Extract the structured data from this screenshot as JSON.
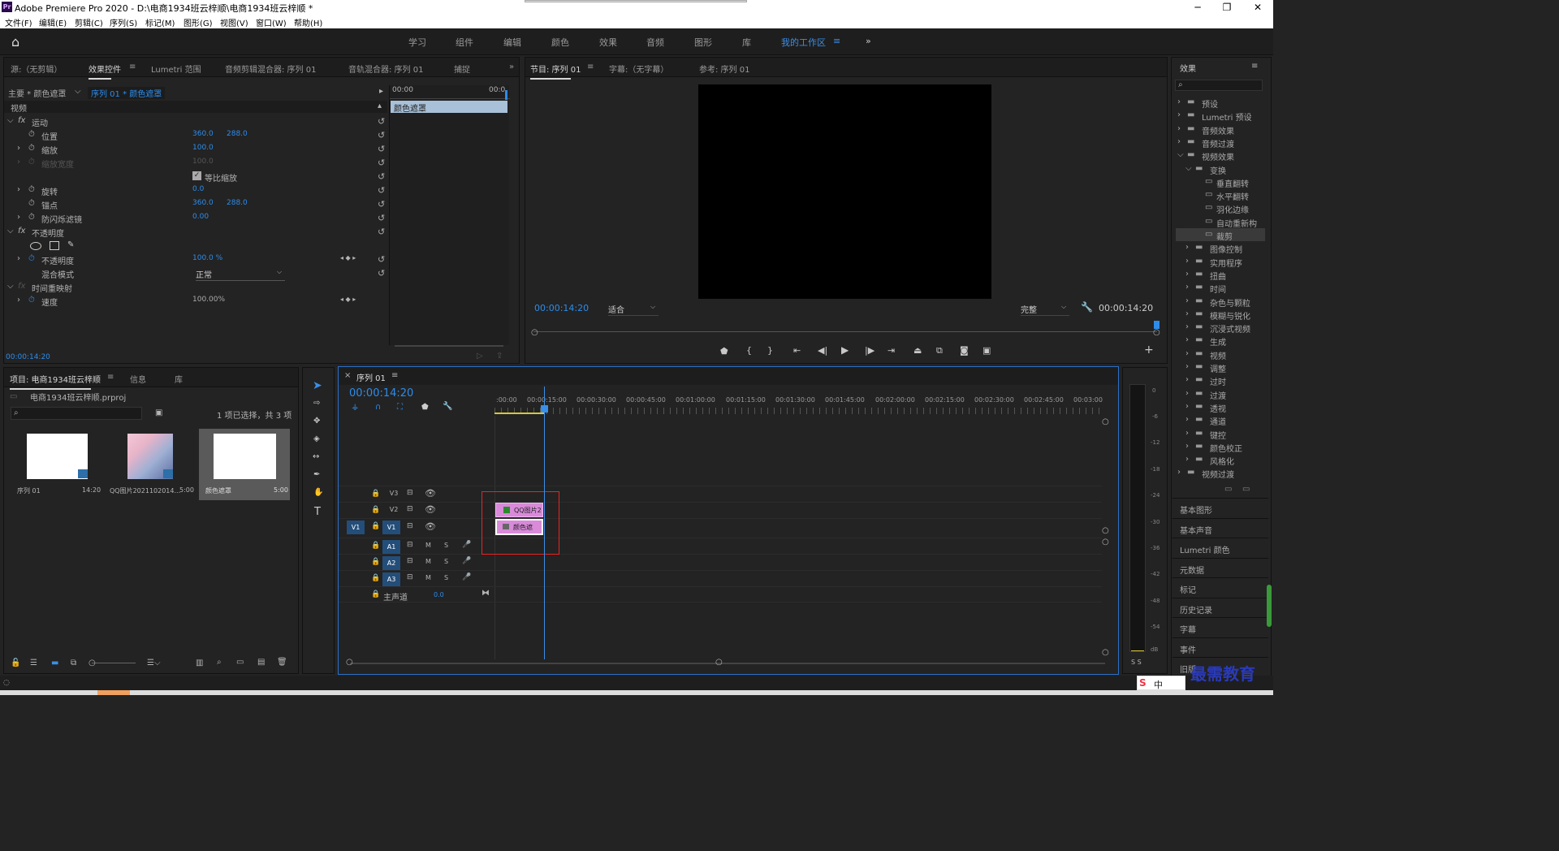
{
  "app": {
    "title": "Adobe Premiere Pro 2020 - D:\\电商1934班云梓顺\\电商1934班云梓顺 *"
  },
  "menu": [
    "文件(F)",
    "编辑(E)",
    "剪辑(C)",
    "序列(S)",
    "标记(M)",
    "图形(G)",
    "视图(V)",
    "窗口(W)",
    "帮助(H)"
  ],
  "workspaces": [
    "学习",
    "组件",
    "编辑",
    "颜色",
    "效果",
    "音频",
    "图形",
    "库",
    "我的工作区"
  ],
  "source_panel": {
    "tabs": [
      "源:（无剪辑）",
      "效果控件",
      "Lumetri 范围",
      "音频剪辑混合器: 序列 01",
      "音轨混合器: 序列 01",
      "捕捉"
    ],
    "master_label": "主要 * 颜色遮罩",
    "clip_label": "序列 01 * 颜色遮罩",
    "video_label": "视频",
    "time_start": "00:00",
    "time_end": "00:0",
    "clip_bar": "颜色遮罩",
    "motion": "运动",
    "position": {
      "label": "位置",
      "x": "360.0",
      "y": "288.0"
    },
    "scale": {
      "label": "缩放",
      "value": "100.0"
    },
    "scale_width": {
      "label": "缩放宽度",
      "value": "100.0"
    },
    "uniform_scale": "等比缩放",
    "rotation": {
      "label": "旋转",
      "value": "0.0"
    },
    "anchor": {
      "label": "锚点",
      "x": "360.0",
      "y": "288.0"
    },
    "antiflicker": {
      "label": "防闪烁滤镜",
      "value": "0.00"
    },
    "opacity_section": "不透明度",
    "opacity": {
      "label": "不透明度",
      "value": "100.0 %"
    },
    "blend": {
      "label": "混合模式",
      "value": "正常"
    },
    "time_remap": "时间重映射",
    "speed": {
      "label": "速度",
      "value": "100.00%"
    },
    "timecode": "00:00:14:20"
  },
  "program_panel": {
    "tabs": [
      "节目: 序列 01",
      "字幕:（无字幕）",
      "参考: 序列 01"
    ],
    "timecode": "00:00:14:20",
    "fit": "适合",
    "quality": "完整",
    "duration": "00:00:14:20"
  },
  "project_panel": {
    "tabs": [
      "项目: 电商1934班云梓顺",
      "信息",
      "库"
    ],
    "file": "电商1934班云梓顺.prproj",
    "selection": "1 项已选择，共 3 项",
    "items": [
      {
        "name": "序列 01",
        "duration": "14:20"
      },
      {
        "name": "QQ图片2021102014...",
        "duration": "5:00"
      },
      {
        "name": "颜色遮罩",
        "duration": "5:00"
      }
    ]
  },
  "timeline": {
    "tab": "序列 01",
    "timecode": "00:00:14:20",
    "ruler": [
      ":00:00",
      "00:00:15:00",
      "00:00:30:00",
      "00:00:45:00",
      "00:01:00:00",
      "00:01:15:00",
      "00:01:30:00",
      "00:01:45:00",
      "00:02:00:00",
      "00:02:15:00",
      "00:02:30:00",
      "00:02:45:00",
      "00:03:00"
    ],
    "video_tracks": [
      "V3",
      "V2",
      "V1"
    ],
    "audio_tracks": [
      "A1",
      "A2",
      "A3"
    ],
    "src_patch": "V1",
    "mute": "M",
    "solo": "S",
    "master_label": "主声道",
    "master_value": "0.0",
    "clips": {
      "v2": "QQ图片2",
      "v1": "颜色遮"
    }
  },
  "vu_meter": {
    "labels": [
      "0",
      "-6",
      "-12",
      "-18",
      "-24",
      "-30",
      "-36",
      "-42",
      "-48",
      "-54",
      "dB"
    ],
    "solo": "S S"
  },
  "effects_panel": {
    "title": "效果",
    "tree": [
      {
        "label": "预设",
        "level": 0,
        "type": "folder"
      },
      {
        "label": "Lumetri 预设",
        "level": 0,
        "type": "folder"
      },
      {
        "label": "音频效果",
        "level": 0,
        "type": "folder"
      },
      {
        "label": "音频过渡",
        "level": 0,
        "type": "folder"
      },
      {
        "label": "视频效果",
        "level": 0,
        "type": "folder",
        "open": true
      },
      {
        "label": "变换",
        "level": 1,
        "type": "folder",
        "open": true
      },
      {
        "label": "垂直翻转",
        "level": 2,
        "type": "fx"
      },
      {
        "label": "水平翻转",
        "level": 2,
        "type": "fx"
      },
      {
        "label": "羽化边缘",
        "level": 2,
        "type": "fx"
      },
      {
        "label": "自动重新构",
        "level": 2,
        "type": "fx"
      },
      {
        "label": "裁剪",
        "level": 2,
        "type": "fx",
        "selected": true
      },
      {
        "label": "图像控制",
        "level": 1,
        "type": "folder"
      },
      {
        "label": "实用程序",
        "level": 1,
        "type": "folder"
      },
      {
        "label": "扭曲",
        "level": 1,
        "type": "folder"
      },
      {
        "label": "时间",
        "level": 1,
        "type": "folder"
      },
      {
        "label": "杂色与颗粒",
        "level": 1,
        "type": "folder"
      },
      {
        "label": "模糊与锐化",
        "level": 1,
        "type": "folder"
      },
      {
        "label": "沉浸式视频",
        "level": 1,
        "type": "folder"
      },
      {
        "label": "生成",
        "level": 1,
        "type": "folder"
      },
      {
        "label": "视频",
        "level": 1,
        "type": "folder"
      },
      {
        "label": "调整",
        "level": 1,
        "type": "folder"
      },
      {
        "label": "过时",
        "level": 1,
        "type": "folder"
      },
      {
        "label": "过渡",
        "level": 1,
        "type": "folder"
      },
      {
        "label": "透视",
        "level": 1,
        "type": "folder"
      },
      {
        "label": "通道",
        "level": 1,
        "type": "folder"
      },
      {
        "label": "键控",
        "level": 1,
        "type": "folder"
      },
      {
        "label": "颜色校正",
        "level": 1,
        "type": "folder"
      },
      {
        "label": "风格化",
        "level": 1,
        "type": "folder"
      },
      {
        "label": "视频过渡",
        "level": 0,
        "type": "folder"
      }
    ],
    "sections": [
      "基本图形",
      "基本声音",
      "Lumetri 颜色",
      "元数据",
      "标记",
      "历史记录",
      "字幕",
      "事件",
      "旧版"
    ]
  },
  "watermark": "最需教育",
  "ime": "中"
}
